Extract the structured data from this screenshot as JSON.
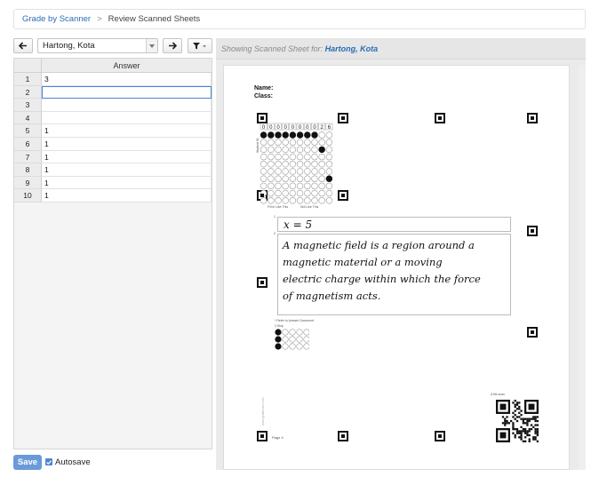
{
  "breadcrumb": {
    "link_label": "Grade by Scanner",
    "separator": ">",
    "current_label": "Review Scanned Sheets"
  },
  "toolbar": {
    "selected_student": "Hartong, Kota"
  },
  "grid": {
    "column_header": "Answer",
    "rows": [
      {
        "num": "1",
        "answer": "3"
      },
      {
        "num": "2",
        "answer": ""
      },
      {
        "num": "3",
        "answer": ""
      },
      {
        "num": "4",
        "answer": ""
      },
      {
        "num": "5",
        "answer": "1"
      },
      {
        "num": "6",
        "answer": "1"
      },
      {
        "num": "7",
        "answer": "1"
      },
      {
        "num": "8",
        "answer": "1"
      },
      {
        "num": "9",
        "answer": "1"
      },
      {
        "num": "10",
        "answer": "1"
      }
    ]
  },
  "footer": {
    "save_label": "Save",
    "autosave_label": "Autosave"
  },
  "viewer": {
    "header_prefix": "Showing Scanned Sheet for:",
    "student_name": "Hartong, Kota"
  },
  "sheet": {
    "name_label": "Name:",
    "class_label": "Class:",
    "id_digits": [
      "0",
      "0",
      "0",
      "0",
      "0",
      "0",
      "0",
      "0",
      "2",
      "6"
    ],
    "student_id_label": "Student ID",
    "fill_like_this": "Fill in Like This",
    "not_like_this": "Not Like This",
    "q1_number": "1",
    "q1_answer": "x = 5",
    "q2_number": "2",
    "q2_answer_lines": [
      "A magnetic field is a region around a",
      "magnetic material or a moving",
      "electric charge within which the force",
      "of magnetism acts."
    ],
    "refer_text": "* Refer to Answer Document",
    "q3_label": "3 Skip",
    "page_label": "Page 4",
    "file_label": "A file scan",
    "side_text": "www.gradecam.com"
  },
  "colors": {
    "link": "#2a6db3",
    "save_button": "#6a9bd8",
    "selection": "#4a86d6"
  }
}
